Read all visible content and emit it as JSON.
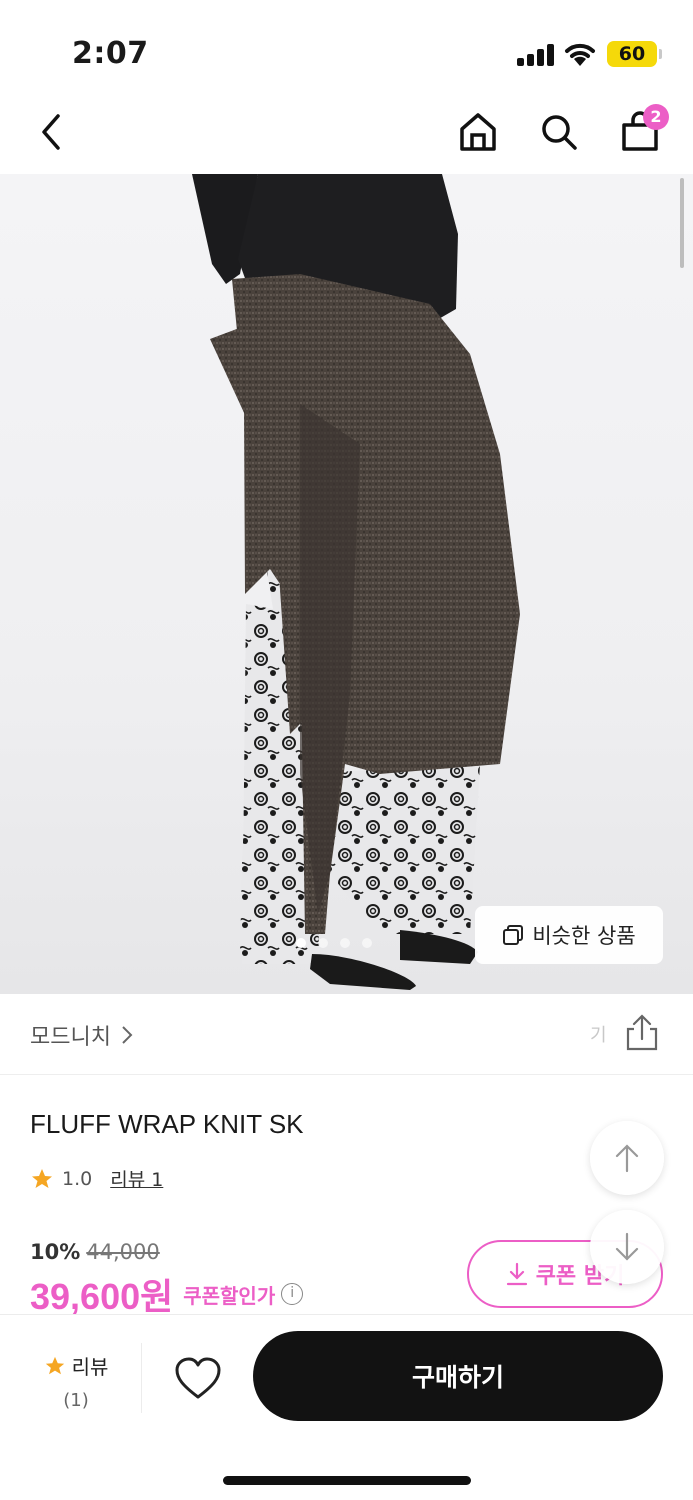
{
  "status_bar": {
    "time": "2:07",
    "battery": "60"
  },
  "nav": {
    "cart_count": "2",
    "icons": [
      "back-icon",
      "home-icon",
      "search-icon",
      "cart-icon"
    ]
  },
  "hero": {
    "similar_label": "비슷한 상품",
    "image_count": 4,
    "active_index": 0
  },
  "brand": {
    "name": "모드니치",
    "share_hint": "기"
  },
  "product": {
    "title": "FLUFF WRAP KNIT SK",
    "rating": "1.0",
    "review_label": "리뷰 1",
    "discount_pct": "10%",
    "original_price": "44,000",
    "final_price": "39,600원",
    "coupon_discount_label": "쿠폰할인가"
  },
  "coupon": {
    "label": "쿠폰 받기"
  },
  "bottom": {
    "review_label": "리뷰",
    "review_count": "(1)",
    "buy_label": "구매하기"
  },
  "colors": {
    "accent": "#ec5ec6",
    "buy_bg": "#121212",
    "star": "#f5a623"
  }
}
